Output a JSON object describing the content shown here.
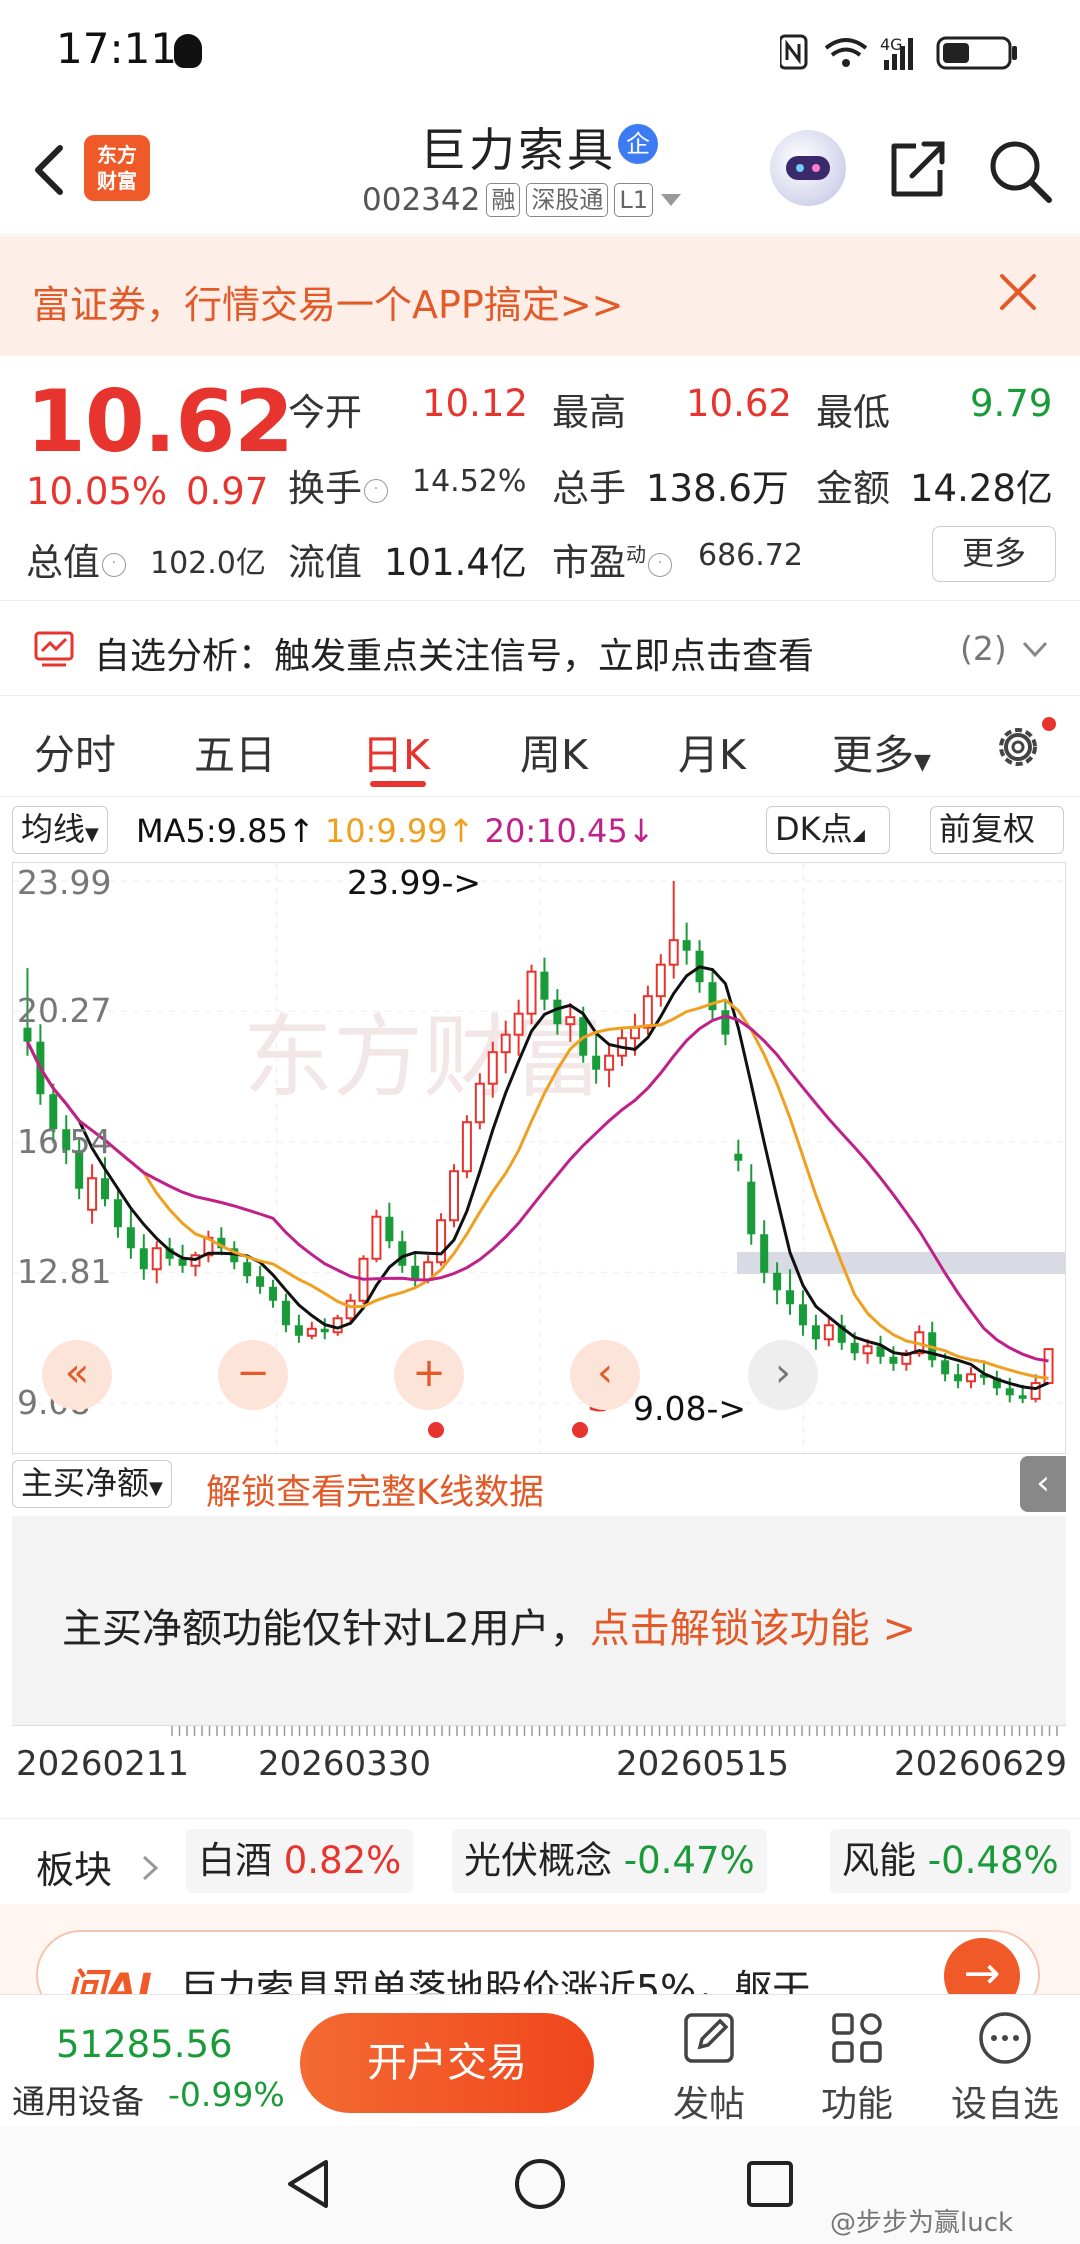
{
  "status": {
    "time": "17:11",
    "network": "4G"
  },
  "header": {
    "logo_line1": "东方",
    "logo_line2": "财富",
    "stock_name": "巨力索具",
    "ent_badge": "企",
    "stock_code": "002342",
    "tag_margin": "融",
    "tag_connect": "深股通",
    "tag_level": "L1"
  },
  "promo": {
    "text": "富证券，行情交易一个APP搞定>>"
  },
  "quote": {
    "price": "10.62",
    "change_pct": "10.05%",
    "change_abs": "0.97",
    "open_label": "今开",
    "open": "10.12",
    "high_label": "最高",
    "high": "10.62",
    "low_label": "最低",
    "low": "9.79",
    "turnover_label": "换手",
    "turnover": "14.52%",
    "volume_label": "总手",
    "volume": "138.6万",
    "amount_label": "金额",
    "amount": "14.28亿",
    "mktcap_label": "总值",
    "mktcap": "102.0亿",
    "float_label": "流值",
    "float_cap": "101.4亿",
    "pe_label": "市盈",
    "pe_sup": "动",
    "pe": "686.72",
    "more_label": "更多"
  },
  "analysis": {
    "label": "自选分析：触发重点关注信号，立即点击查看",
    "count": "(2)"
  },
  "tabs": [
    "分时",
    "五日",
    "日K",
    "周K",
    "月K",
    "更多"
  ],
  "active_tab": "日K",
  "indicator": {
    "ma_select": "均线",
    "ma5": "MA5:9.85↑",
    "ma10": "10:9.99↑",
    "ma20": "20:10.45↓",
    "dk_label": "DK点",
    "adjust_label": "前复权"
  },
  "colors": {
    "up": "#e8342e",
    "down": "#1a9b3a",
    "ma5": "#111111",
    "ma10": "#f0a020",
    "ma20": "#c0208a",
    "accent": "#f05a28"
  },
  "chart_data": {
    "type": "candlestick",
    "y_ticks": [
      "23.99",
      "20.27",
      "16.54",
      "12.81",
      "9.08"
    ],
    "ylim": [
      9.08,
      23.99
    ],
    "x_ticks": [
      "20260211",
      "20260330",
      "20260515",
      "20260629"
    ],
    "max_label": "23.99->",
    "min_label": "9.08->",
    "signal_label": "S",
    "ohlc": [
      [
        19.8,
        21.5,
        19.0,
        19.4
      ],
      [
        19.4,
        19.9,
        17.6,
        17.9
      ],
      [
        17.9,
        18.2,
        16.5,
        16.9
      ],
      [
        16.9,
        17.3,
        15.9,
        16.3
      ],
      [
        16.3,
        16.6,
        14.9,
        15.2
      ],
      [
        14.6,
        15.9,
        14.2,
        15.5
      ],
      [
        15.5,
        16.1,
        14.7,
        14.9
      ],
      [
        14.9,
        15.2,
        13.8,
        14.1
      ],
      [
        14.1,
        14.6,
        13.2,
        13.5
      ],
      [
        13.5,
        13.9,
        12.6,
        12.9
      ],
      [
        12.9,
        13.7,
        12.5,
        13.5
      ],
      [
        13.5,
        13.8,
        13.0,
        13.2
      ],
      [
        13.2,
        13.6,
        12.8,
        13.0
      ],
      [
        13.0,
        13.4,
        12.7,
        13.3
      ],
      [
        13.3,
        14.0,
        13.1,
        13.8
      ],
      [
        13.8,
        14.1,
        13.3,
        13.5
      ],
      [
        13.5,
        13.7,
        12.9,
        13.1
      ],
      [
        13.1,
        13.3,
        12.5,
        12.7
      ],
      [
        12.7,
        13.0,
        12.2,
        12.4
      ],
      [
        12.4,
        12.6,
        11.8,
        12.0
      ],
      [
        12.0,
        12.2,
        11.1,
        11.3
      ],
      [
        11.3,
        11.6,
        10.8,
        11.0
      ],
      [
        11.0,
        11.4,
        10.9,
        11.2
      ],
      [
        11.2,
        11.5,
        10.9,
        11.1
      ],
      [
        11.1,
        11.6,
        11.0,
        11.5
      ],
      [
        11.5,
        12.2,
        11.4,
        12.0
      ],
      [
        12.0,
        13.3,
        11.9,
        13.2
      ],
      [
        13.2,
        14.6,
        13.1,
        14.4
      ],
      [
        14.4,
        14.8,
        13.5,
        13.7
      ],
      [
        13.7,
        14.0,
        12.8,
        13.0
      ],
      [
        13.0,
        13.4,
        12.4,
        12.6
      ],
      [
        12.6,
        13.3,
        12.5,
        13.1
      ],
      [
        13.1,
        14.5,
        13.0,
        14.3
      ],
      [
        14.3,
        15.9,
        14.1,
        15.7
      ],
      [
        15.7,
        17.3,
        15.5,
        17.1
      ],
      [
        17.1,
        18.5,
        16.9,
        18.2
      ],
      [
        18.2,
        19.4,
        17.8,
        19.1
      ],
      [
        19.1,
        20.0,
        18.5,
        19.6
      ],
      [
        19.6,
        20.6,
        19.0,
        20.2
      ],
      [
        20.2,
        21.6,
        19.9,
        21.4
      ],
      [
        21.4,
        21.8,
        20.3,
        20.6
      ],
      [
        20.6,
        20.9,
        19.6,
        19.9
      ],
      [
        19.9,
        20.5,
        19.4,
        20.1
      ],
      [
        20.1,
        20.4,
        18.8,
        19.0
      ],
      [
        19.0,
        19.6,
        18.2,
        18.6
      ],
      [
        18.6,
        19.3,
        18.1,
        19.0
      ],
      [
        19.0,
        19.8,
        18.7,
        19.5
      ],
      [
        19.5,
        20.2,
        19.0,
        19.8
      ],
      [
        19.8,
        21.0,
        19.6,
        20.7
      ],
      [
        20.7,
        21.9,
        20.4,
        21.6
      ],
      [
        21.6,
        23.99,
        21.2,
        22.3
      ],
      [
        22.3,
        22.8,
        21.6,
        22.0
      ],
      [
        22.0,
        22.3,
        20.8,
        21.1
      ],
      [
        21.1,
        21.5,
        20.0,
        20.3
      ],
      [
        20.3,
        20.6,
        19.3,
        19.6
      ],
      [
        16.2,
        16.6,
        15.7,
        16.0
      ],
      [
        15.4,
        15.9,
        13.6,
        13.9
      ],
      [
        13.9,
        14.3,
        12.5,
        12.8
      ],
      [
        12.8,
        13.1,
        11.9,
        12.3
      ],
      [
        12.3,
        12.9,
        11.6,
        11.9
      ],
      [
        11.9,
        12.3,
        11.0,
        11.3
      ],
      [
        11.3,
        11.6,
        10.6,
        10.9
      ],
      [
        10.9,
        11.5,
        10.7,
        11.3
      ],
      [
        11.3,
        11.6,
        10.6,
        10.8
      ],
      [
        10.8,
        11.1,
        10.3,
        10.5
      ],
      [
        10.5,
        10.9,
        10.2,
        10.7
      ],
      [
        10.7,
        11.0,
        10.2,
        10.4
      ],
      [
        10.4,
        10.7,
        10.0,
        10.2
      ],
      [
        10.2,
        10.6,
        10.0,
        10.5
      ],
      [
        10.5,
        11.3,
        10.4,
        11.1
      ],
      [
        11.1,
        11.4,
        10.1,
        10.3
      ],
      [
        10.3,
        10.5,
        9.7,
        9.9
      ],
      [
        9.9,
        10.2,
        9.5,
        9.7
      ],
      [
        9.7,
        10.1,
        9.5,
        9.9
      ],
      [
        9.9,
        10.3,
        9.6,
        9.8
      ],
      [
        9.8,
        10.0,
        9.3,
        9.5
      ],
      [
        9.5,
        9.8,
        9.1,
        9.3
      ],
      [
        9.3,
        9.6,
        9.08,
        9.2
      ],
      [
        9.2,
        9.9,
        9.1,
        9.65
      ],
      [
        9.65,
        10.62,
        9.79,
        10.62
      ]
    ]
  },
  "lower": {
    "net_select": "主买净额",
    "unlock": "解锁查看完整K线数据",
    "l2_text": "主买净额功能仅针对L2用户，",
    "l2_link": "点击解锁该功能 >"
  },
  "sectors": {
    "label": "板块",
    "items": [
      {
        "name": "白酒",
        "change": "0.82%"
      },
      {
        "name": "光伏概念",
        "change": "-0.47%"
      },
      {
        "name": "风能",
        "change": "-0.48%"
      }
    ]
  },
  "ai_news": {
    "logo": "问AI",
    "text": "巨力索具罚单落地股价涨近5%，躯干..."
  },
  "bottom": {
    "index_value": "51285.56",
    "index_name": "通用设备",
    "index_change": "-0.99%",
    "open_account": "开户交易",
    "post": "发帖",
    "function": "功能",
    "watchlist": "设自选"
  },
  "watermark": "@步步为赢luck"
}
